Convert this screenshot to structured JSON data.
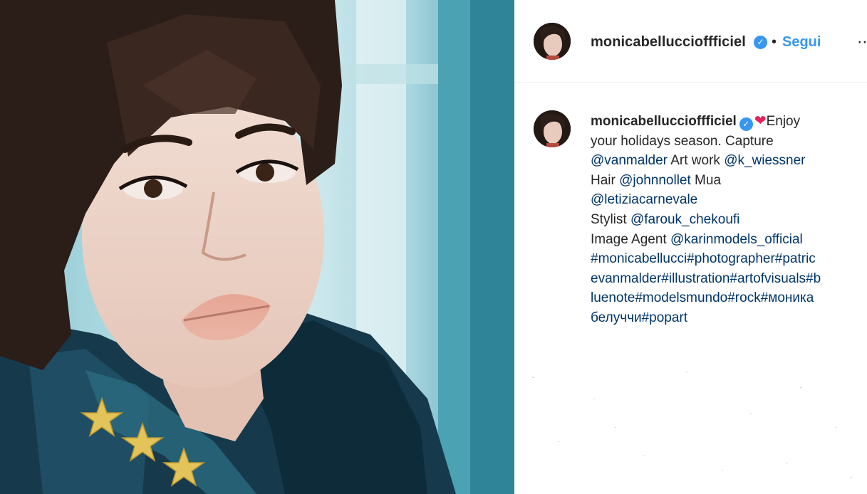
{
  "post": {
    "username": "monicabelluccioffficiel",
    "verified_icon": "check-icon",
    "separator": "•",
    "follow_label": "Segui",
    "more_icon": "ellipsis-icon"
  },
  "caption": {
    "username": "monicabelluccioffficiel",
    "heart": "❤",
    "lines": [
      [
        {
          "t": "Enjoy",
          "k": "text"
        }
      ],
      [
        {
          "t": "your holidays season. Capture",
          "k": "text"
        }
      ],
      [
        {
          "t": "@vanmalder",
          "k": "link"
        },
        {
          "t": " Art work ",
          "k": "text"
        },
        {
          "t": "@k_wiessner",
          "k": "link"
        }
      ],
      [
        {
          "t": "Hair ",
          "k": "text"
        },
        {
          "t": "@johnnollet",
          "k": "link"
        },
        {
          "t": " Mua",
          "k": "text"
        }
      ],
      [
        {
          "t": "@letiziacarnevale",
          "k": "link"
        }
      ],
      [
        {
          "t": "Stylist ",
          "k": "text"
        },
        {
          "t": "@farouk_chekoufi",
          "k": "link"
        }
      ],
      [
        {
          "t": "Image Agent ",
          "k": "text"
        },
        {
          "t": "@karinmodels_official",
          "k": "link"
        }
      ],
      [
        {
          "t": "#monicabellucci#photographer#patric",
          "k": "link"
        }
      ],
      [
        {
          "t": "evanmalder#illustration#artofvisuals#b",
          "k": "link"
        }
      ],
      [
        {
          "t": "luenote#modelsmundo#rock#моника",
          "k": "link"
        }
      ],
      [
        {
          "t": "белуччи#popart",
          "k": "link"
        }
      ]
    ]
  },
  "colors": {
    "link": "#003569",
    "follow": "#3897f0",
    "verified": "#3897f0",
    "heart": "#e0245e"
  }
}
